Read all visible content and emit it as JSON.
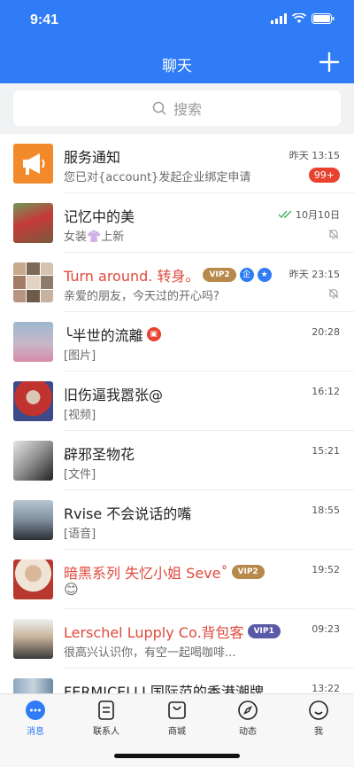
{
  "status_bar": {
    "time": "9:41"
  },
  "header": {
    "title": "聊天",
    "add_icon": "plus-icon"
  },
  "search": {
    "placeholder": "搜索"
  },
  "chats": [
    {
      "name": "服务通知",
      "message": "您已对{account}发起企业绑定申请",
      "time": "昨天 13:15",
      "badge": "99+"
    },
    {
      "name": "记忆中的美",
      "message_prefix": "女装",
      "message_suffix": "上新",
      "time": "10月10日",
      "muted": true,
      "read_receipt": true
    },
    {
      "name": "Turn around. 转身。",
      "vip": "VIP2",
      "qi_badge": "企",
      "message": "亲爱的朋友，今天过的开心吗?",
      "time": "昨天 23:15",
      "muted": true,
      "highlight": true
    },
    {
      "name": "╰半世的流離",
      "message": "[图片]",
      "time": "20:28"
    },
    {
      "name": "旧伤逼我嚣张@",
      "message": "[视频]",
      "time": "16:12"
    },
    {
      "name": "辟邪圣物花",
      "message": "[文件]",
      "time": "15:21"
    },
    {
      "name": "Rvise 不会说话的嘴",
      "message": "[语音]",
      "time": "18:55"
    },
    {
      "name": "暗黑系列 失忆小姐 Seve˚",
      "vip": "VIP2",
      "message": "😊",
      "time": "19:52",
      "highlight": true
    },
    {
      "name": "Lerschel Lupply Co.背包客",
      "vip": "VIP1",
      "message": "很高兴认识你，有空一起喝咖啡...",
      "time": "09:23",
      "highlight": true
    },
    {
      "name": "FERMICELLI 国际范的香港潮牌",
      "time": "13:22"
    }
  ],
  "tabs": [
    {
      "label": "消息",
      "icon": "message-icon",
      "active": true
    },
    {
      "label": "联系人",
      "icon": "contacts-icon"
    },
    {
      "label": "商城",
      "icon": "shop-icon"
    },
    {
      "label": "动态",
      "icon": "compass-icon"
    },
    {
      "label": "我",
      "icon": "profile-icon"
    }
  ],
  "colors": {
    "accent": "#2f7cf6",
    "alert": "#e8412f",
    "highlight_name": "#e0493c"
  }
}
